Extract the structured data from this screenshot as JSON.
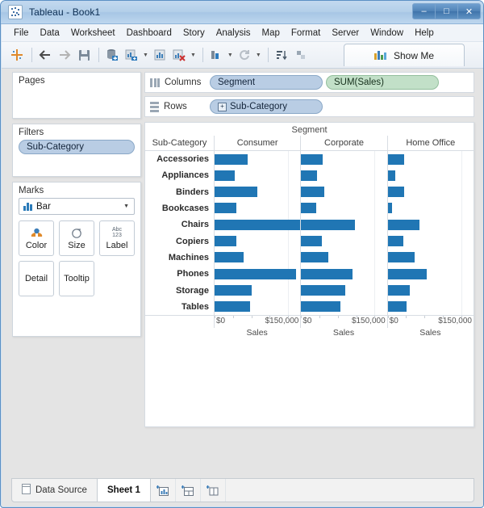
{
  "window": {
    "title": "Tableau - Book1",
    "icon": "tableau-logo-icon",
    "controls": {
      "minimize": "–",
      "maximize": "□",
      "close": "✕"
    }
  },
  "menubar": {
    "items": [
      "File",
      "Data",
      "Worksheet",
      "Dashboard",
      "Story",
      "Analysis",
      "Map",
      "Format",
      "Server",
      "Window",
      "Help"
    ]
  },
  "toolbar": {
    "show_me_label": "Show Me",
    "buttons": [
      "tableau-start-icon",
      "back-arrow-icon",
      "forward-arrow-icon",
      "save-icon",
      "new-data-source-icon",
      "new-worksheet-icon",
      "duplicate-sheet-icon",
      "clear-sheet-icon",
      "swap-rows-columns-icon",
      "sort-ascending-icon",
      "sort-descending-icon",
      "refresh-icon",
      "group-members-icon",
      "highlight-icon"
    ]
  },
  "left_panel": {
    "pages": {
      "title": "Pages"
    },
    "filters": {
      "title": "Filters",
      "pills": [
        "Sub-Category"
      ]
    },
    "marks": {
      "title": "Marks",
      "mark_type": "Bar",
      "buttons": [
        {
          "label": "Color",
          "icon": "color-palette-icon"
        },
        {
          "label": "Size",
          "icon": "size-icon"
        },
        {
          "label": "Label",
          "icon": "abc-123-label-icon"
        },
        {
          "label": "Detail",
          "icon": "detail-icon"
        },
        {
          "label": "Tooltip",
          "icon": "tooltip-icon"
        }
      ]
    }
  },
  "shelves": {
    "columns": {
      "label": "Columns",
      "pills": [
        {
          "text": "Segment",
          "color": "blue"
        },
        {
          "text": "SUM(Sales)",
          "color": "green"
        }
      ]
    },
    "rows": {
      "label": "Rows",
      "pills": [
        {
          "text": "Sub-Category",
          "color": "blue",
          "expand": "+"
        }
      ]
    }
  },
  "chart_data": {
    "type": "bar",
    "title": "Segment",
    "row_header": "Sub-Category",
    "categories": [
      "Accessories",
      "Appliances",
      "Binders",
      "Bookcases",
      "Chairs",
      "Copiers",
      "Machines",
      "Phones",
      "Storage",
      "Tables"
    ],
    "panels": [
      "Consumer",
      "Corporate",
      "Home Office"
    ],
    "xlabel": "Sales",
    "xlim": [
      0,
      175000
    ],
    "xtick_labels": [
      "$0",
      "$150,000"
    ],
    "xtick_values": [
      0,
      150000
    ],
    "grid": true,
    "legend": "none",
    "bar_color": "#2076b4",
    "series": [
      {
        "name": "Consumer",
        "values": [
          68000,
          41000,
          88000,
          45000,
          175000,
          44000,
          59000,
          167000,
          75000,
          72000
        ]
      },
      {
        "name": "Corporate",
        "values": [
          44000,
          33000,
          48000,
          31000,
          110000,
          42000,
          55000,
          105000,
          90000,
          80000
        ]
      },
      {
        "name": "Home Office",
        "values": [
          33000,
          16000,
          34000,
          8000,
          65000,
          32000,
          55000,
          80000,
          45000,
          38000
        ]
      }
    ]
  },
  "statusbar": {
    "data_source_label": "Data Source",
    "data_source_icon": "data-source-icon",
    "sheet_tabs": [
      {
        "label": "Sheet 1",
        "active": true
      }
    ],
    "new_buttons": [
      {
        "icon": "new-worksheet-icon"
      },
      {
        "icon": "new-dashboard-icon"
      },
      {
        "icon": "new-story-icon"
      }
    ]
  }
}
